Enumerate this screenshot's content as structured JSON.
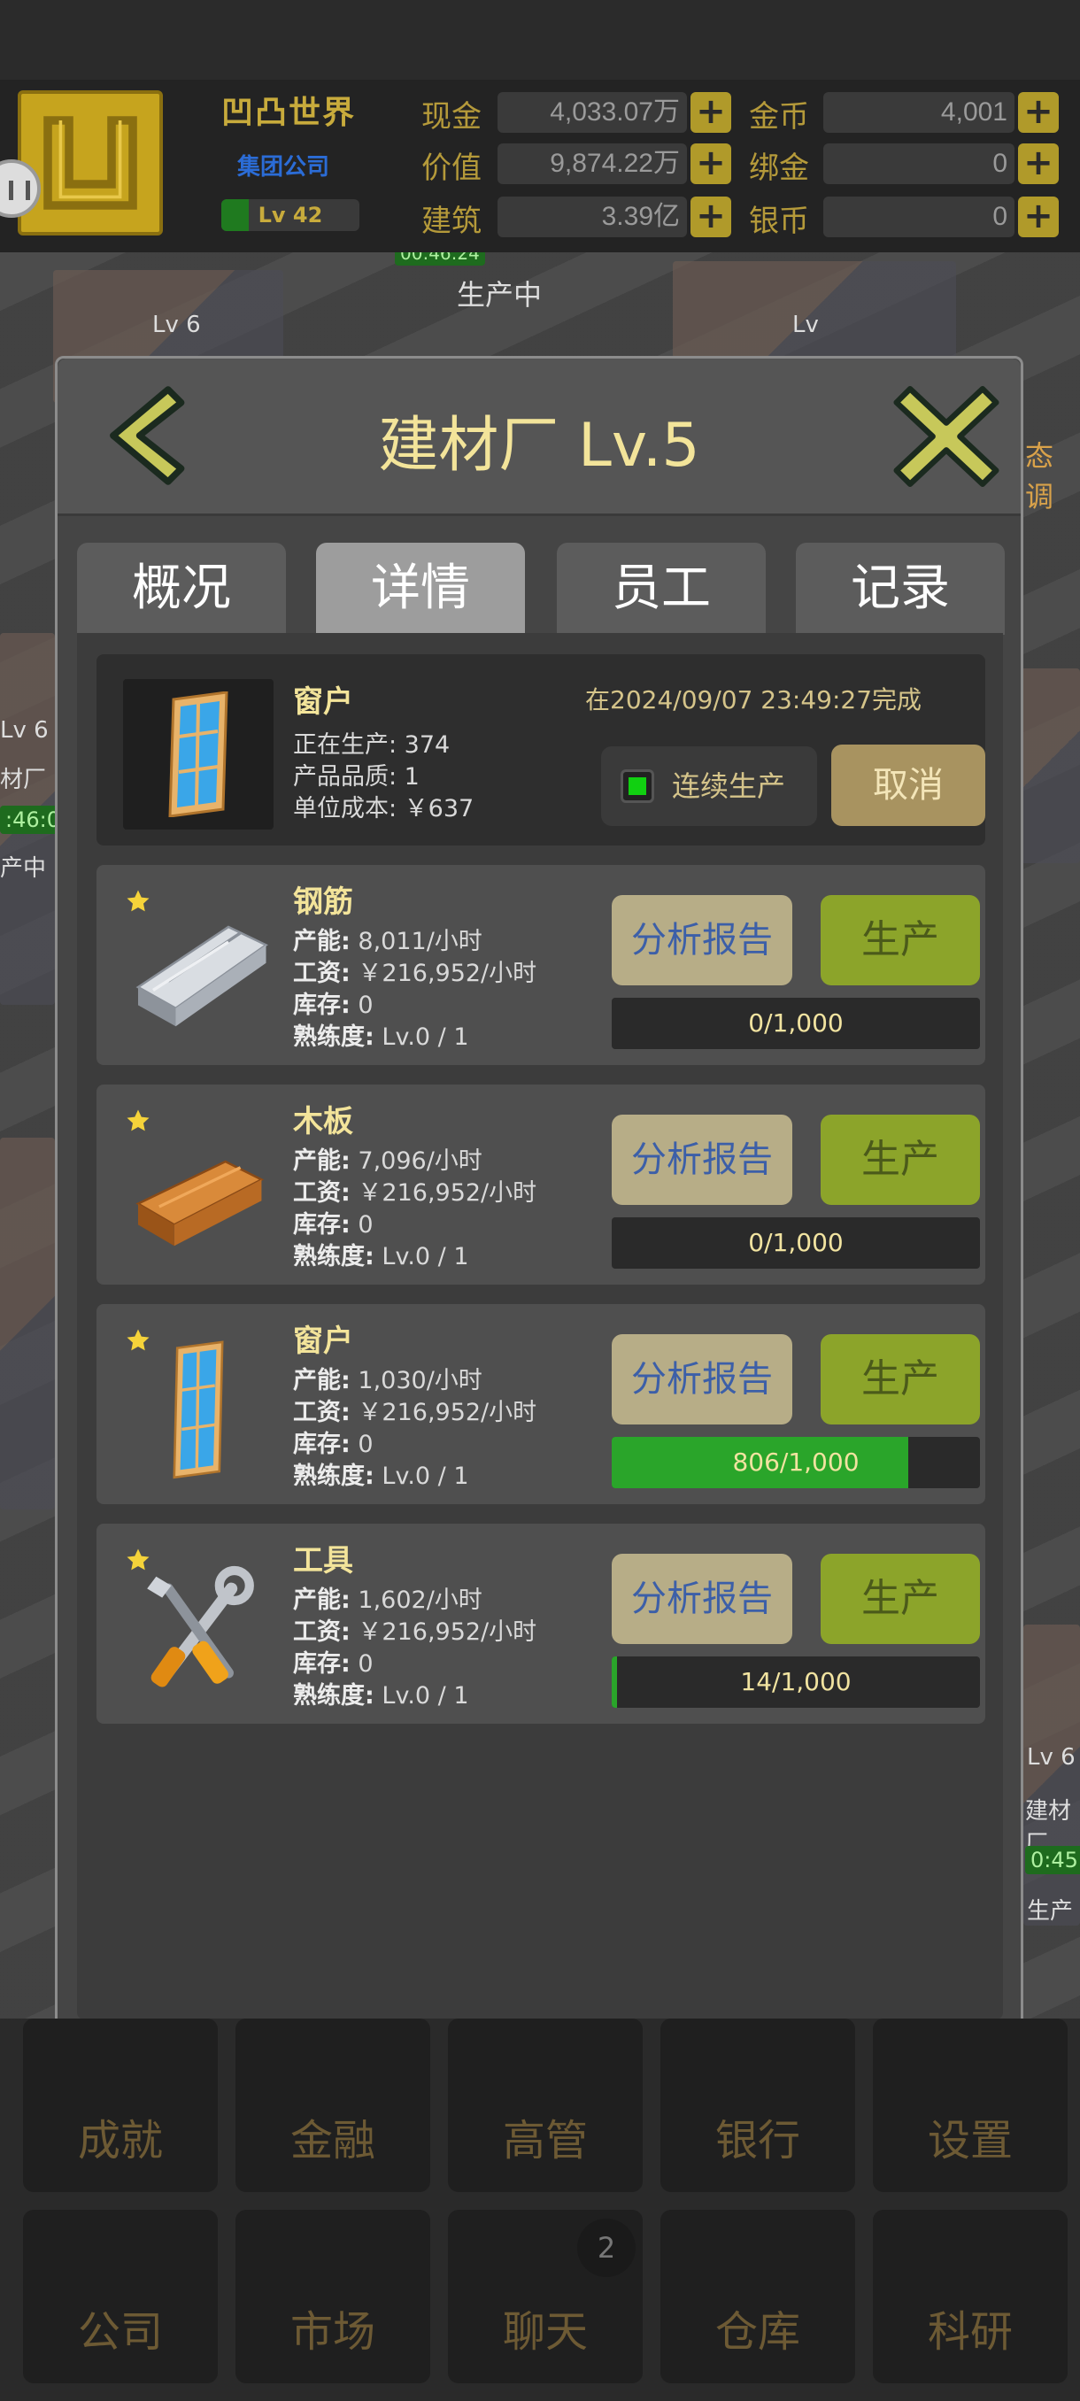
{
  "hud": {
    "company_name": "凹凸世界",
    "company_type": "集团公司",
    "level": "Lv 42",
    "level_progress": 0.2,
    "stats": [
      {
        "label": "现金",
        "value": "4,033.07万"
      },
      {
        "label": "价值",
        "value": "9,874.22万"
      },
      {
        "label": "建筑",
        "value": "3.39亿"
      },
      {
        "label": "金币",
        "value": "4,001"
      },
      {
        "label": "绑金",
        "value": "0"
      },
      {
        "label": "银币",
        "value": "0"
      }
    ]
  },
  "background": {
    "labels": [
      "Lv 6",
      "生产中",
      "Lv",
      "Lv 6",
      "材厂",
      "产中",
      "Lv 6",
      "建材厂",
      "生产",
      "态调"
    ],
    "timers": [
      "00:46:24",
      ":46:0",
      "0:45:0"
    ]
  },
  "dialog": {
    "title": "建材厂 Lv.5",
    "tabs": [
      {
        "label": "概况",
        "active": false
      },
      {
        "label": "详情",
        "active": true
      },
      {
        "label": "员工",
        "active": false
      },
      {
        "label": "记录",
        "active": false
      }
    ],
    "current": {
      "name": "窗户",
      "producing": "正在生产: 374",
      "quality": "产品品质: 1",
      "unit_cost": "单位成本: ￥637",
      "completion": "在2024/09/07 23:49:27完成",
      "continuous_label": "连续生产",
      "continuous_on": true,
      "cancel_label": "取消"
    },
    "capacity_label": "产能:",
    "wage_label": "工资:",
    "stock_label": "库存:",
    "skill_label": "熟练度:",
    "analysis_label": "分析报告",
    "produce_label": "生产",
    "products": [
      {
        "name": "钢筋",
        "icon": "steel-bar-icon",
        "capacity": "8,011/小时",
        "wage": "￥216,952/小时",
        "stock": "0",
        "skill": "Lv.0 / 1",
        "progress_text": "0/1,000",
        "progress": 0
      },
      {
        "name": "木板",
        "icon": "wood-plank-icon",
        "capacity": "7,096/小时",
        "wage": "￥216,952/小时",
        "stock": "0",
        "skill": "Lv.0 / 1",
        "progress_text": "0/1,000",
        "progress": 0
      },
      {
        "name": "窗户",
        "icon": "window-icon",
        "capacity": "1,030/小时",
        "wage": "￥216,952/小时",
        "stock": "0",
        "skill": "Lv.0 / 1",
        "progress_text": "806/1,000",
        "progress": 0.806
      },
      {
        "name": "工具",
        "icon": "tools-icon",
        "capacity": "1,602/小时",
        "wage": "￥216,952/小时",
        "stock": "0",
        "skill": "Lv.0 / 1",
        "progress_text": "14/1,000",
        "progress": 0.014
      }
    ]
  },
  "bottom_nav": {
    "row1": [
      "成就",
      "金融",
      "高管",
      "银行",
      "设置"
    ],
    "row2": [
      "公司",
      "市场",
      "聊天",
      "仓库",
      "科研"
    ],
    "chat_badge": "2"
  },
  "colors": {
    "accent_gold": "#c8ab3c",
    "title_yellow": "#f3e49a",
    "produce_green": "#8ca42a",
    "progress_green": "#2aa52a"
  }
}
